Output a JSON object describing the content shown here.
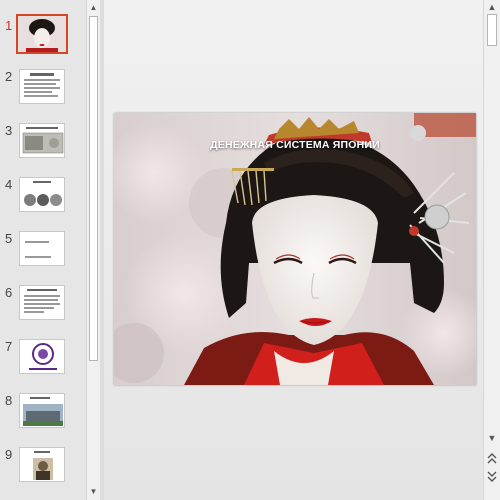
{
  "slide_panel": {
    "slides": [
      {
        "number": "1",
        "active": true
      },
      {
        "number": "2",
        "active": false
      },
      {
        "number": "3",
        "active": false
      },
      {
        "number": "4",
        "active": false
      },
      {
        "number": "5",
        "active": false
      },
      {
        "number": "6",
        "active": false
      },
      {
        "number": "7",
        "active": false
      },
      {
        "number": "8",
        "active": false
      },
      {
        "number": "9",
        "active": false
      }
    ]
  },
  "current_slide": {
    "title": "ДЕНЕЖНАЯ СИСТЕМА ЯПОНИИ",
    "image": "geisha-portrait"
  },
  "colors": {
    "active_accent": "#d24726",
    "pane_bg": "#e6e6e6",
    "lips": "#c8161b"
  },
  "icons": {
    "scroll_up": "triangle-up-icon",
    "scroll_down": "triangle-down-icon",
    "prev_slide": "double-chevron-up-icon",
    "next_slide": "double-chevron-down-icon"
  }
}
